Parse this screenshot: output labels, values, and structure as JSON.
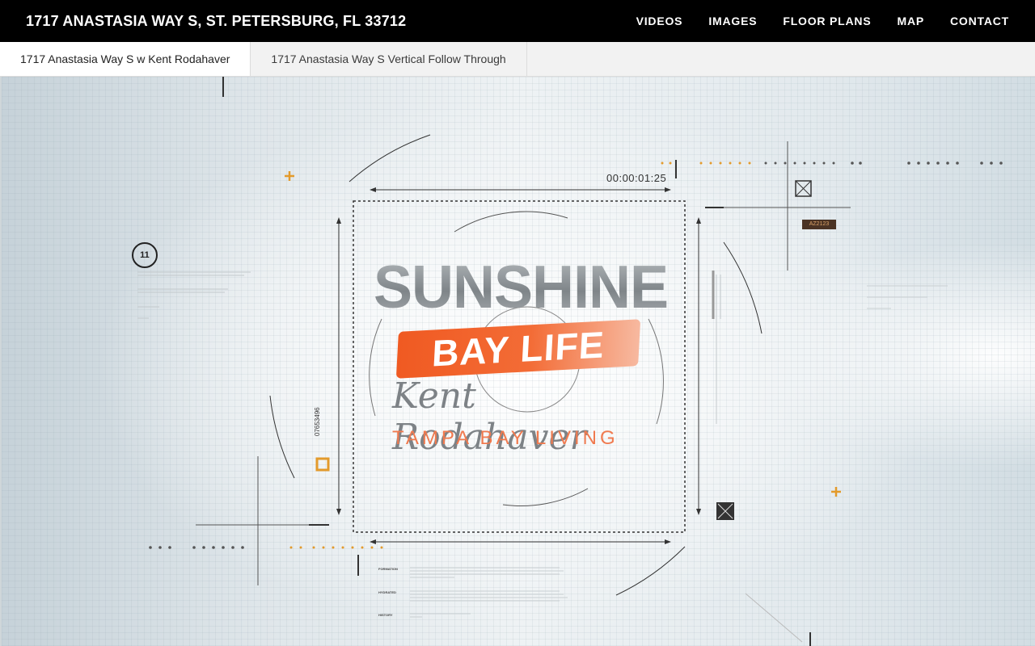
{
  "header": {
    "title": "1717 ANASTASIA WAY S, ST. PETERSBURG, FL 33712",
    "nav": [
      "VIDEOS",
      "IMAGES",
      "FLOOR PLANS",
      "MAP",
      "CONTACT"
    ]
  },
  "tabs": [
    {
      "label": "1717 Anastasia Way S w Kent Rodahaver",
      "active": true
    },
    {
      "label": "1717 Anastasia Way S Vertical Follow Through",
      "active": false
    }
  ],
  "video": {
    "timecode": "00:00:01:25",
    "vertical_code": "07653496",
    "counter": "11",
    "badge": "AZ2123",
    "logo": {
      "line1": "SUNSHINE",
      "line2": "BAY LIFE",
      "name": "Kent Rodahaver",
      "tagline": "TAMPA BAY LIVING"
    },
    "labels": {
      "formation": "FORMATION",
      "hydrated": "HYDRATED",
      "history": "HISTORY"
    }
  },
  "colors": {
    "header_bg": "#000000",
    "accent_orange": "#f05a22",
    "hud_gold": "#e39a2b"
  }
}
